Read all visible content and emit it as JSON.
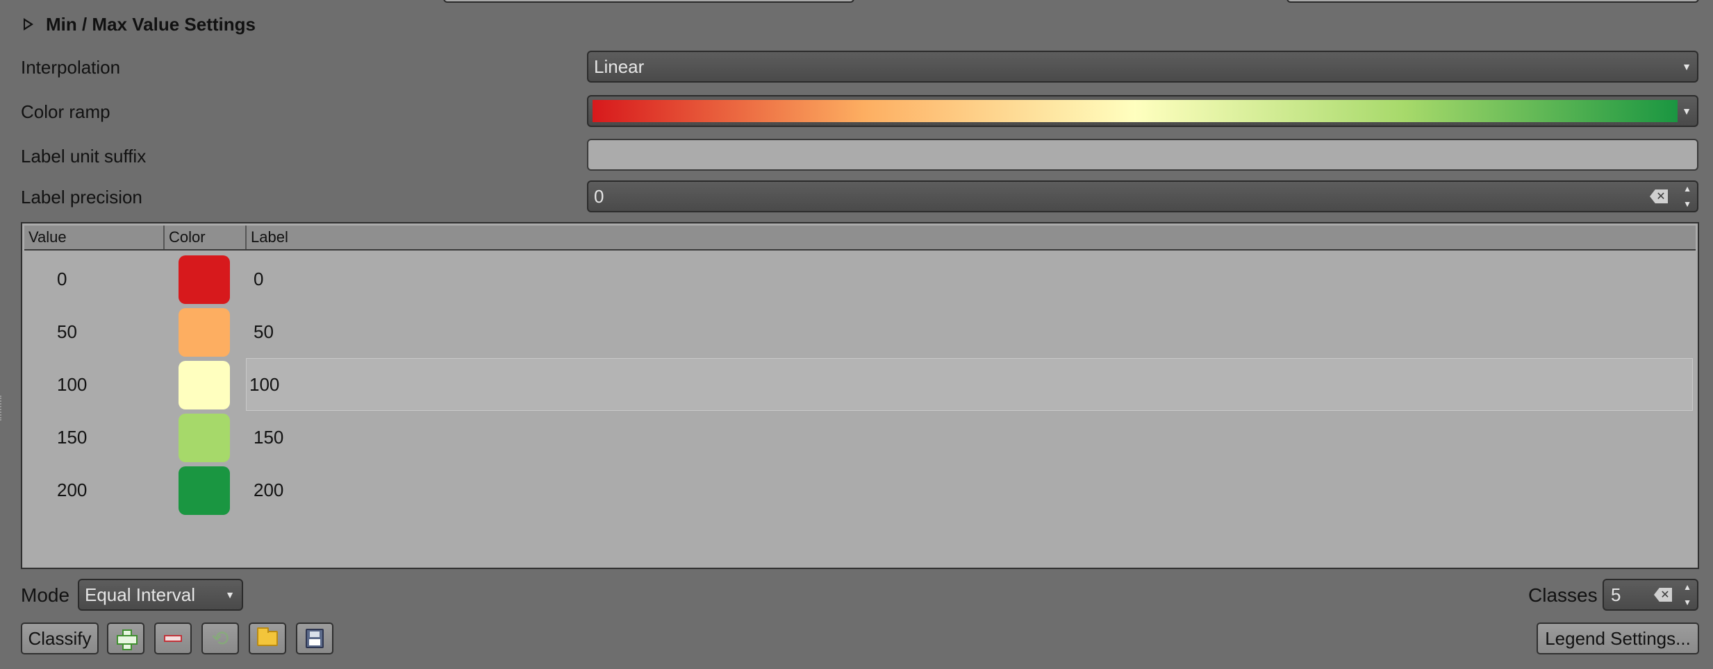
{
  "section": {
    "title": "Min / Max Value Settings"
  },
  "form": {
    "interpolation": {
      "label": "Interpolation",
      "value": "Linear"
    },
    "color_ramp": {
      "label": "Color ramp",
      "stops": [
        "#d7191c",
        "#fdae61",
        "#ffffbf",
        "#a6d96a",
        "#1a9641"
      ]
    },
    "label_unit_suffix": {
      "label": "Label unit suffix",
      "value": ""
    },
    "label_precision": {
      "label": "Label precision",
      "value": "0"
    }
  },
  "table": {
    "headers": {
      "value": "Value",
      "color": "Color",
      "label": "Label"
    },
    "rows": [
      {
        "value": "0",
        "color": "#d7191c",
        "label": "0"
      },
      {
        "value": "50",
        "color": "#fdae61",
        "label": "50"
      },
      {
        "value": "100",
        "color": "#ffffbf",
        "label": "100"
      },
      {
        "value": "150",
        "color": "#a6d96a",
        "label": "150"
      },
      {
        "value": "200",
        "color": "#1a9641",
        "label": "200"
      }
    ],
    "selected_row": 2
  },
  "mode": {
    "label": "Mode",
    "value": "Equal Interval"
  },
  "classes": {
    "label": "Classes",
    "value": "5"
  },
  "buttons": {
    "classify": "Classify",
    "legend_settings": "Legend Settings...",
    "icons": [
      "plus-icon",
      "minus-icon",
      "refresh-icon",
      "folder-icon",
      "save-icon"
    ]
  }
}
